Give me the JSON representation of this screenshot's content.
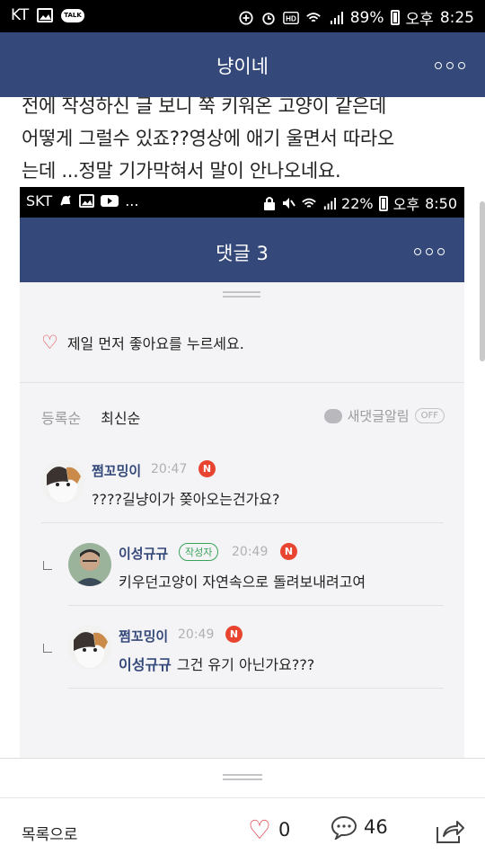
{
  "status_bar": {
    "carrier": "KT",
    "battery": "89%",
    "time_period": "오후",
    "time": "8:25"
  },
  "app_bar": {
    "title": "냥이네"
  },
  "post": {
    "lines": [
      "전에 작성하신 글 보니 쭉 키워온 고양이 같은데",
      "어떻게 그럴수 있죠??영상에 애기 울면서 따라오",
      "는데 ...정말 기가막혀서 말이 안나오네요."
    ]
  },
  "embedded": {
    "status_bar": {
      "carrier": "SKT",
      "more": "...",
      "battery": "22%",
      "time_period": "오후",
      "time": "8:50"
    },
    "header": {
      "title": "댓글 3"
    },
    "like_prompt": "제일 먼저 좋아요를 누르세요.",
    "sort": {
      "oldest": "등록순",
      "newest": "최신순"
    },
    "notify": {
      "label": "새댓글알림",
      "toggle": "OFF"
    },
    "comments": [
      {
        "author": "쩜꼬밍이",
        "time": "20:47",
        "badge": "N",
        "text": "????길냥이가 쫒아오는건가요?"
      },
      {
        "author": "이성규규",
        "author_badge": "작성자",
        "time": "20:49",
        "badge": "N",
        "text": "키우던고양이 자연속으로 돌려보내려고여"
      },
      {
        "author": "쩜꼬밍이",
        "time": "20:49",
        "badge": "N",
        "mention": "이성규규",
        "text": "그건 유기 아닌가요???"
      }
    ]
  },
  "bottom": {
    "list_label": "목록으로",
    "like_count": "0",
    "comment_count": "46"
  },
  "colors": {
    "header_blue": "#34497a",
    "heart_red": "#e0454f",
    "badge_red": "#e8442f",
    "author_green": "#3aa35a"
  },
  "icons": [
    "image-icon",
    "talk-icon",
    "add-circle-icon",
    "alarm-icon",
    "hd-icon",
    "wifi-icon",
    "signal-icon",
    "battery-icon",
    "more-dots-icon",
    "heart-icon",
    "comment-bubble-icon",
    "share-icon",
    "reply-arrow-icon"
  ]
}
